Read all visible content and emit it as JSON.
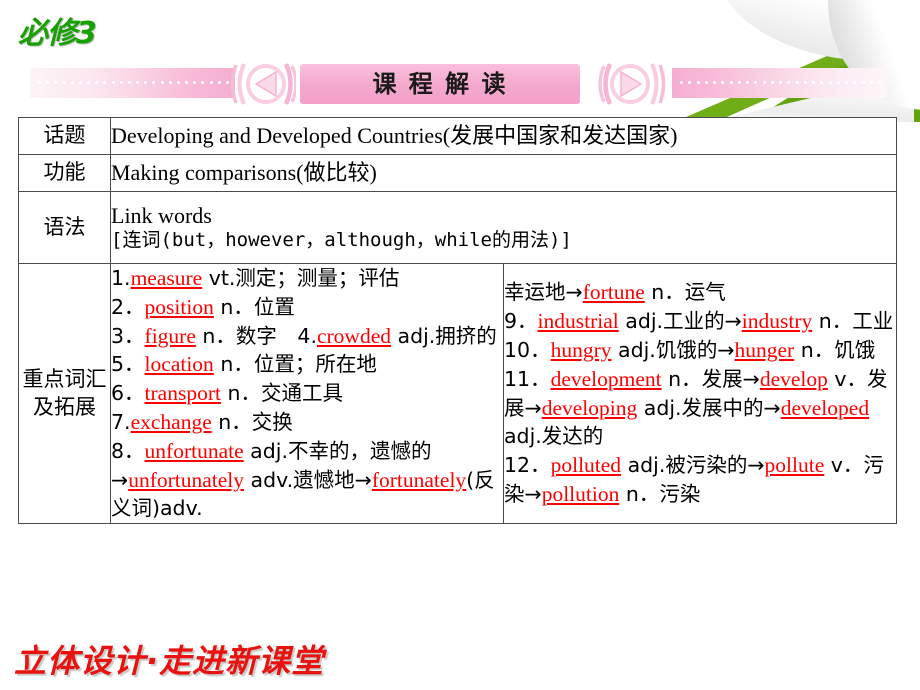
{
  "unit_badge": "必修3",
  "banner": {
    "title": "课 程 解 读",
    "left_arrow_icon": "triangle-left-icon",
    "right_arrow_icon": "triangle-right-icon",
    "accent_pink": "#f5a9cd",
    "accent_green": "#62a30b"
  },
  "table": {
    "rows": [
      {
        "label": "话题",
        "value": "Developing and Developed Countries(发展中国家和发达国家)"
      },
      {
        "label": "功能",
        "value": "Making comparisons(做比较)"
      },
      {
        "label": "语法",
        "line1": "Link words",
        "line2": "[连词(but，however，although，while的用法)]"
      }
    ],
    "vocab": {
      "label": "重点词汇及拓展",
      "left_entries": [
        {
          "num": "1.",
          "word": "measure",
          "rest": " vt.测定；测量；评估"
        },
        {
          "num": "2．",
          "word": "position",
          "rest": " n．位置"
        },
        {
          "num": "3．",
          "word": "figure",
          "rest": " n．数字　",
          "num2": "4.",
          "word2": "crowded",
          "rest2": " adj.拥挤的"
        },
        {
          "num": "5．",
          "word": "location",
          "rest": " n．位置；所在地"
        },
        {
          "num": "6．",
          "word": "transport",
          "rest": " n．交通工具"
        },
        {
          "num": "7.",
          "word": "exchange",
          "rest": " n．交换"
        },
        {
          "num": "8．",
          "word": "unfortunate",
          "rest": " adj.不幸的，遗憾的→",
          "word2": "unfortunately",
          "rest2": " adv.遗憾地→",
          "word3": "fortunately",
          "rest3": "(反义词)adv."
        }
      ],
      "right_entries": [
        {
          "pre": "幸运地→",
          "word": "fortune",
          "rest": " n．运气"
        },
        {
          "num": "9．",
          "word": "industrial",
          "rest": " adj.工业的→",
          "word2": "industry",
          "rest2": " n．工业"
        },
        {
          "num": "10．",
          "word": "hungry",
          "rest": " adj.饥饿的→",
          "word2": "hunger",
          "rest2": " n．饥饿"
        },
        {
          "num": "11．",
          "word": "development",
          "rest": " n．发展→",
          "word2": "develop",
          "rest2": " v．发展→",
          "word3": "developing",
          "rest3": " adj.发展中的→",
          "word4": "developed",
          "rest4": " adj.发达的"
        },
        {
          "num": "12．",
          "word": "polluted",
          "rest": " adj.被污染的→",
          "word2": "pollute",
          "rest2": " v．污染→",
          "word3": "pollution",
          "rest3": " n．污染"
        }
      ]
    }
  },
  "footer_logo": "立体设计·走进新课堂"
}
